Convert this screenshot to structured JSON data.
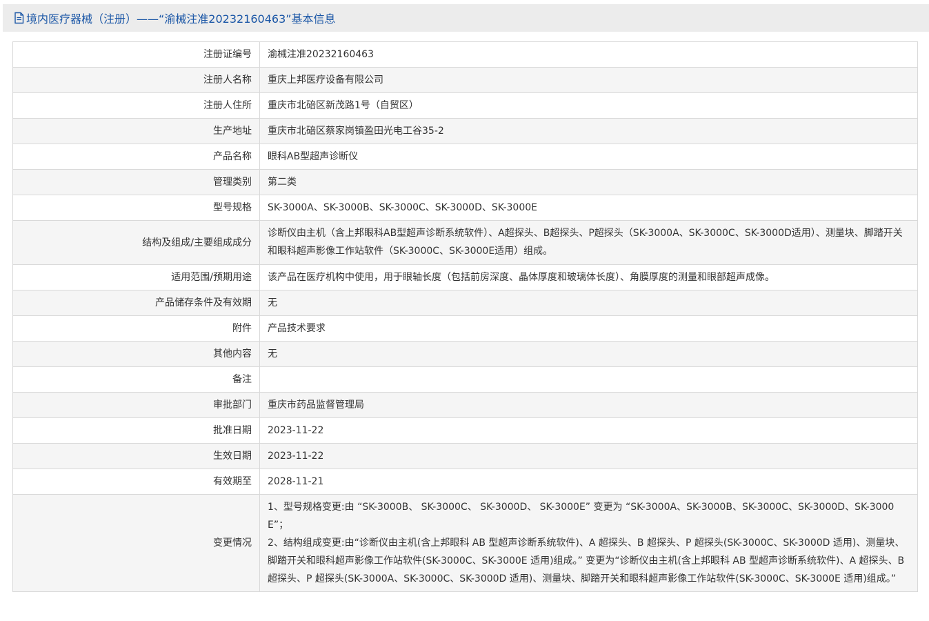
{
  "header": {
    "title": "境内医疗器械（注册）——“渝械注准20232160463”基本信息"
  },
  "rows": [
    {
      "label": "注册证编号",
      "value": "渝械注准20232160463"
    },
    {
      "label": "注册人名称",
      "value": "重庆上邦医疗设备有限公司"
    },
    {
      "label": "注册人住所",
      "value": "重庆市北碚区新茂路1号（自贸区）"
    },
    {
      "label": "生产地址",
      "value": "重庆市北碚区蔡家岗镇盈田光电工谷35-2"
    },
    {
      "label": "产品名称",
      "value": "眼科AB型超声诊断仪"
    },
    {
      "label": "管理类别",
      "value": "第二类"
    },
    {
      "label": "型号规格",
      "value": "SK-3000A、SK-3000B、SK-3000C、SK-3000D、SK-3000E"
    },
    {
      "label": "结构及组成/主要组成成分",
      "value": "诊断仪由主机（含上邦眼科AB型超声诊断系统软件）、A超探头、B超探头、P超探头（SK-3000A、SK-3000C、SK-3000D适用）、测量块、脚踏开关和眼科超声影像工作站软件（SK-3000C、SK-3000E适用）组成。"
    },
    {
      "label": "适用范围/预期用途",
      "value": "该产品在医疗机构中使用，用于眼轴长度（包括前房深度、晶体厚度和玻璃体长度）、角膜厚度的测量和眼部超声成像。"
    },
    {
      "label": "产品储存条件及有效期",
      "value": "无"
    },
    {
      "label": "附件",
      "value": "产品技术要求"
    },
    {
      "label": "其他内容",
      "value": "无"
    },
    {
      "label": "备注",
      "value": ""
    },
    {
      "label": "审批部门",
      "value": "重庆市药品监督管理局"
    },
    {
      "label": "批准日期",
      "value": "2023-11-22"
    },
    {
      "label": "生效日期",
      "value": "2023-11-22"
    },
    {
      "label": "有效期至",
      "value": "2028-11-21"
    }
  ],
  "changes": {
    "label": "变更情况",
    "line1": "1、型号规格变更:由 “SK-3000B、 SK-3000C、 SK-3000D、 SK-3000E” 变更为 “SK-3000A、SK-3000B、SK-3000C、SK-3000D、SK-3000E”；",
    "line2": "2、结构组成变更:由“诊断仪由主机(含上邦眼科 AB 型超声诊断系统软件)、A 超探头、B 超探头、P 超探头(SK-3000C、SK-3000D 适用)、测量块、脚踏开关和眼科超声影像工作站软件(SK-3000C、SK-3000E 适用)组成。” 变更为“诊断仪由主机(含上邦眼科 AB 型超声诊断系统软件)、A 超探头、B 超探头、P 超探头(SK-3000A、SK-3000C、SK-3000D 适用)、测量块、脚踏开关和眼科超声影像工作站软件(SK-3000C、SK-3000E 适用)组成。”"
  }
}
